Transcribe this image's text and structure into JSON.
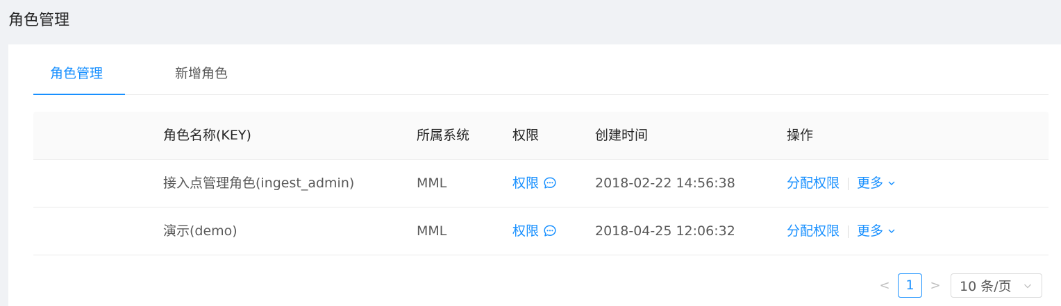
{
  "page": {
    "title": "角色管理"
  },
  "tabs": [
    {
      "label": "角色管理",
      "active": true
    },
    {
      "label": "新增角色",
      "active": false
    }
  ],
  "table": {
    "columns": [
      "角色名称(KEY)",
      "所属系统",
      "权限",
      "创建时间",
      "操作"
    ],
    "rows": [
      {
        "name": "接入点管理角色(ingest_admin)",
        "system": "MML",
        "permission": "权限",
        "created": "2018-02-22 14:56:38",
        "action_assign": "分配权限",
        "action_more": "更多"
      },
      {
        "name": "演示(demo)",
        "system": "MML",
        "permission": "权限",
        "created": "2018-04-25 12:06:32",
        "action_assign": "分配权限",
        "action_more": "更多"
      }
    ]
  },
  "pagination": {
    "prev": "<",
    "current": "1",
    "next": ">",
    "page_size": "10 条/页"
  },
  "icons": {
    "permission": "chat-bubble-icon",
    "more": "chevron-down-icon",
    "select": "chevron-down-icon"
  },
  "colors": {
    "accent": "#1890ff",
    "background": "#f0f2f5"
  }
}
